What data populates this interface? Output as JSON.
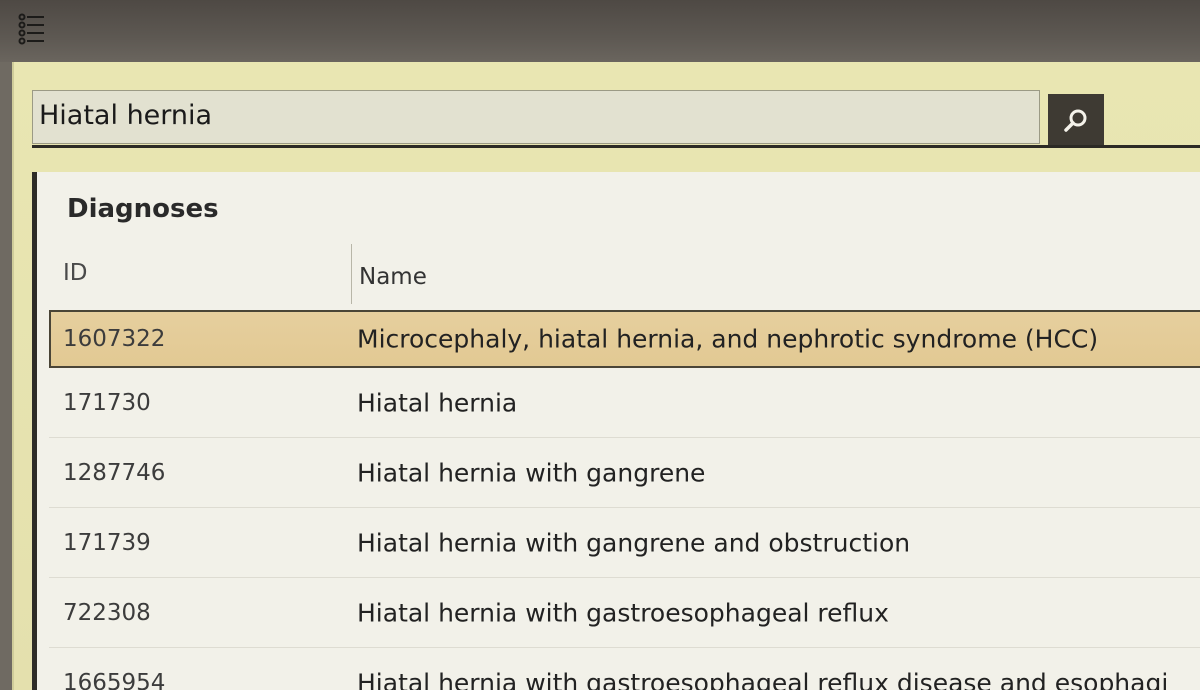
{
  "search": {
    "value": "Hiatal hernia",
    "button_icon": "search-icon"
  },
  "menu": {
    "icon": "list-menu-icon"
  },
  "panel": {
    "title": "Diagnoses",
    "columns": {
      "id": "ID",
      "name": "Name"
    },
    "rows": [
      {
        "id": "1607322",
        "name": "Microcephaly, hiatal hernia, and nephrotic syndrome (HCC)",
        "selected": true
      },
      {
        "id": "171730",
        "name": "Hiatal hernia",
        "selected": false
      },
      {
        "id": "1287746",
        "name": "Hiatal hernia with gangrene",
        "selected": false
      },
      {
        "id": "171739",
        "name": "Hiatal hernia with gangrene and obstruction",
        "selected": false
      },
      {
        "id": "722308",
        "name": "Hiatal hernia with gastroesophageal reflux",
        "selected": false
      },
      {
        "id": "1665954",
        "name": "Hiatal hernia with gastroesophageal reflux disease and esophagi",
        "selected": false
      }
    ]
  },
  "colors": {
    "window_bg": "#e9e6b2",
    "selected_row": "#e4cc98",
    "search_button": "#3e3a33"
  }
}
